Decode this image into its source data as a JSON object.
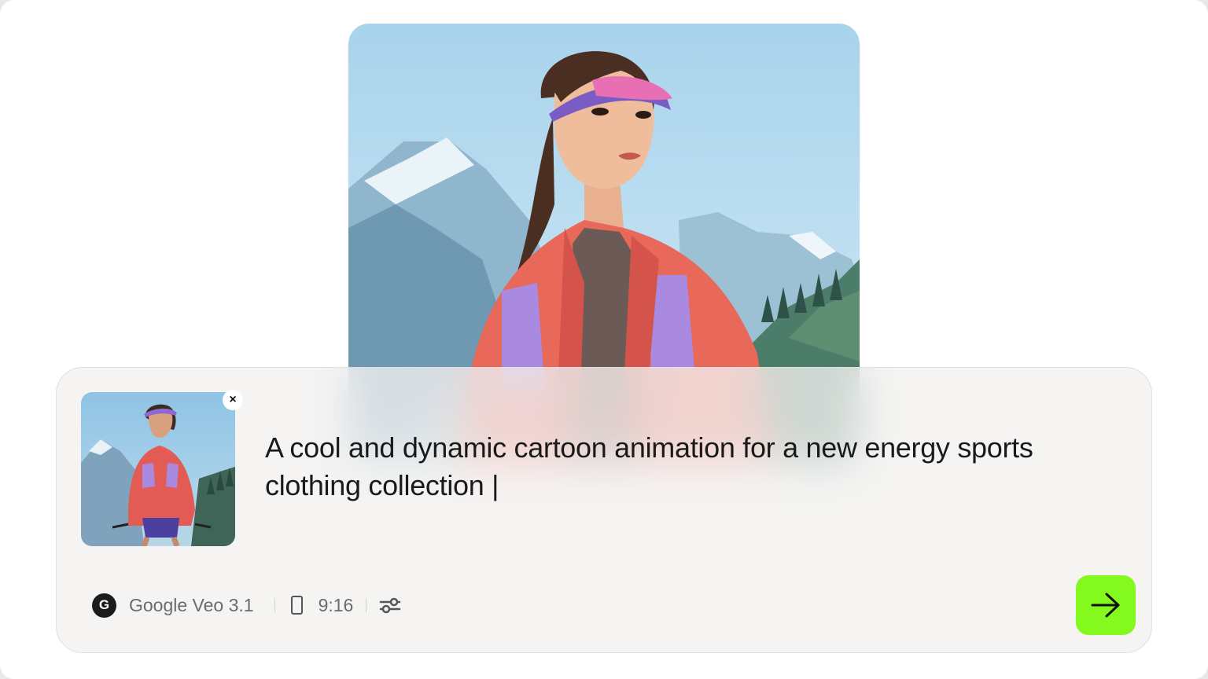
{
  "prompt": {
    "text": "A cool and dynamic cartoon animation for a new energy sports clothing collection |"
  },
  "attachment": {
    "remove_label": "×"
  },
  "toolbar": {
    "model_logo_letter": "G",
    "model_name": "Google Veo 3.1",
    "aspect_ratio": "9:16"
  },
  "icons": {
    "remove": "close-icon",
    "model": "google-logo-icon",
    "ratio": "portrait-phone-icon",
    "settings": "sliders-icon",
    "send": "arrow-right-icon"
  },
  "colors": {
    "send_button": "#84f91d",
    "panel_bg": "#f2f1f0",
    "text": "#1a1a1a",
    "muted": "#6b6b6b"
  }
}
